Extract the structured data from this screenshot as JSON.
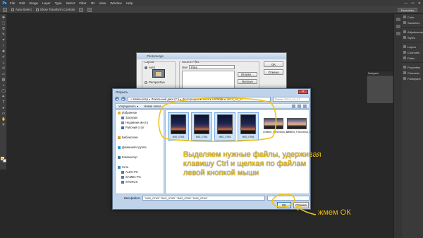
{
  "photoshop": {
    "logo": "Ps",
    "menu": [
      "File",
      "Edit",
      "Image",
      "Layer",
      "Type",
      "Select",
      "Filter",
      "3D",
      "View",
      "Window",
      "Help"
    ],
    "window_controls": [
      "—",
      "▭",
      "✕"
    ],
    "options": {
      "auto_select": "Auto-Select",
      "transform_controls": "Show Transform Controls"
    },
    "workspace": "Essentials",
    "right_panel": [
      "Color",
      "Swatches",
      "Adjustments",
      "Styles",
      "Layers",
      "Channels",
      "Paths",
      "Properties",
      "Character",
      "Paragraph"
    ],
    "navigator_title": "Navigator",
    "fg_color": "#f0a020",
    "bg_color": "#ffffff"
  },
  "photomerge": {
    "title": "Photomerge",
    "layout_label": "Layout",
    "auto_label": "Auto",
    "perspective_label": "Perspective",
    "source_files_label": "Source Files",
    "use_label": "Use:",
    "use_value": "Files",
    "browse_label": "Browse...",
    "remove_label": "Remove",
    "ok_label": "OK",
    "cancel_label": "Отмена"
  },
  "open_dialog": {
    "title": "Открыть",
    "close_label": "✕",
    "path": "« Компьютер ▸ Локальный диск (C:) ▸ фотографии ▸ 2014 ▸ Октябрь ▸ 2014_10_27",
    "search_placeholder": "Поиск: 2014_10_27",
    "toolbar": {
      "organize": "Упорядочить ▾",
      "new_folder": "Новая папка"
    },
    "nav_tree": [
      {
        "label": "Избранное",
        "level": "top",
        "icon": "star-icon",
        "color": "#e6b422"
      },
      {
        "label": "Загрузки",
        "level": "sub",
        "icon": "download-icon",
        "color": "#4a7fc0"
      },
      {
        "label": "Недавние места",
        "level": "sub",
        "icon": "recent-places-icon",
        "color": "#7a8aa0"
      },
      {
        "label": "Рабочий стол",
        "level": "sub",
        "icon": "desktop-icon",
        "color": "#3a6fb0"
      },
      {
        "label": "",
        "level": "top",
        "icon": "",
        "color": ""
      },
      {
        "label": "Библиотеки",
        "level": "top",
        "icon": "library-icon",
        "color": "#c9a040"
      },
      {
        "label": "",
        "level": "top",
        "icon": "",
        "color": ""
      },
      {
        "label": "Домашняя группа",
        "level": "top",
        "icon": "homegroup-icon",
        "color": "#3a9ad0"
      },
      {
        "label": "",
        "level": "top",
        "icon": "",
        "color": ""
      },
      {
        "label": "Компьютер",
        "level": "top",
        "icon": "computer-icon",
        "color": "#5a7a9a"
      },
      {
        "label": "",
        "level": "top",
        "icon": "",
        "color": ""
      },
      {
        "label": "Сеть",
        "level": "top",
        "icon": "network-icon",
        "color": "#4a8ac0"
      },
      {
        "label": "ALEX-PC",
        "level": "sub",
        "icon": "pc-icon",
        "color": "#5a7a9a"
      },
      {
        "label": "SAMBA-PC",
        "level": "sub",
        "icon": "pc-icon",
        "color": "#5a7a9a"
      },
      {
        "label": "STORUX",
        "level": "sub",
        "icon": "pc-icon",
        "color": "#5a7a9a"
      }
    ],
    "files": [
      {
        "name": "IMG_0763",
        "selected": true,
        "kind": "portrait"
      },
      {
        "name": "IMG_0764",
        "selected": true,
        "kind": "portrait"
      },
      {
        "name": "IMG_0765",
        "selected": true,
        "kind": "portrait"
      },
      {
        "name": "IMG_0766",
        "selected": true,
        "kind": "portrait"
      },
      {
        "name": "Untitled_Panorama_09",
        "selected": false,
        "kind": "land"
      },
      {
        "name": "Untitled_Panorama_09",
        "selected": false,
        "kind": "land"
      }
    ],
    "filename_label": "Имя файла:",
    "filename_value": "\"IMG_0763\" \"IMG_0765\" \"IMG_0766\" \"IMG_0764\"",
    "filetype_value": "",
    "ok_label": "OK",
    "cancel_label": "Отмена"
  },
  "annotations": {
    "main_note": "Выделяем нужные файлы, удерживая клавишу Ctrl и щелкая по файлам левой кнопкой мыши",
    "ok_note": "жмем ОК",
    "color": "#f0c419"
  }
}
